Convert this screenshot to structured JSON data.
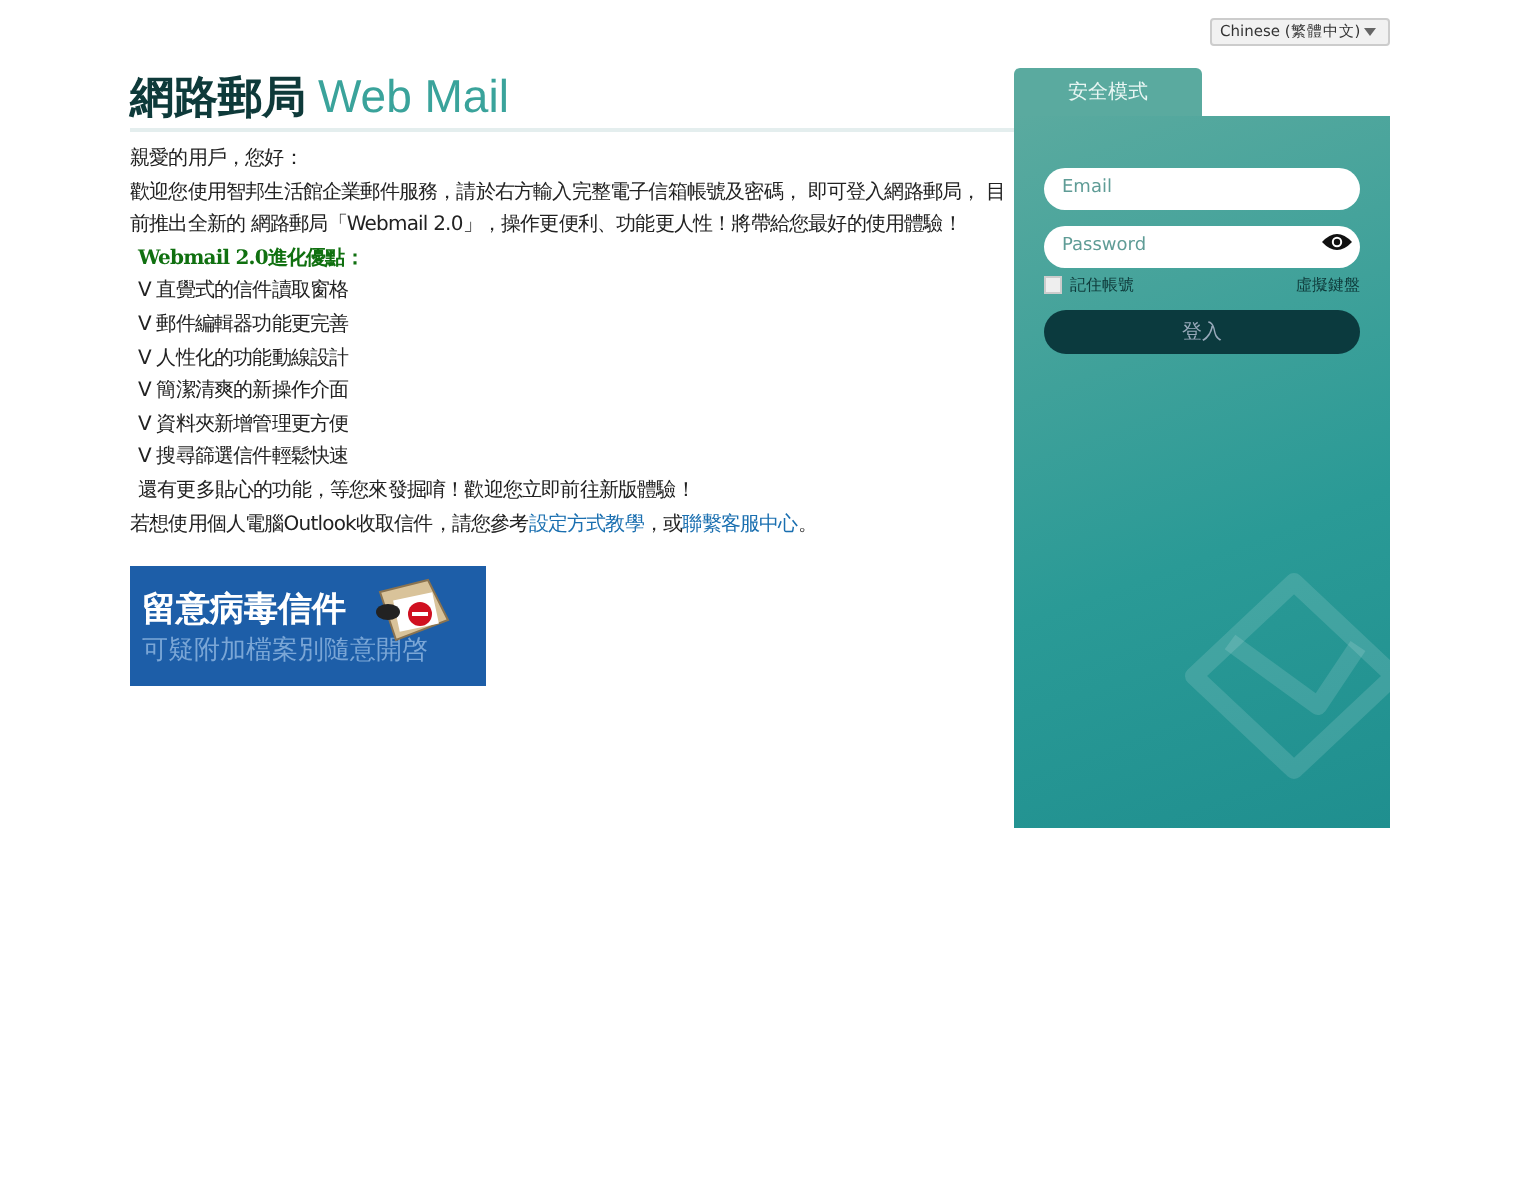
{
  "language_select": {
    "value": "Chinese (繁體中文)"
  },
  "header": {
    "title_cjk": "網路郵局",
    "title_latin": "Web Mail"
  },
  "intro": {
    "greeting": "親愛的用戶，您好：",
    "welcome": "歡迎您使用智邦生活館企業郵件服務，請於右方輸入完整電子信箱帳號及密碼， 即可登入網路郵局， 目前推出全新的 網路郵局「Webmail 2.0」，操作更便利、功能更人性！將帶給您最好的使用體驗！",
    "features_title": "Webmail 2.0進化優點：",
    "features": [
      "V 直覺式的信件讀取窗格",
      "V 郵件編輯器功能更完善",
      "V 人性化的功能動線設計",
      "V 簡潔清爽的新操作介面",
      "V 資料夾新增管理更方便",
      "V 搜尋篩選信件輕鬆快速"
    ],
    "more": "還有更多貼心的功能，等您來發掘唷！歡迎您立即前往新版體驗！",
    "outlook_prefix": "若想使用個人電腦Outlook收取信件，請您參考",
    "outlook_link1": "設定方式教學",
    "outlook_mid": "，或",
    "outlook_link2": "聯繫客服中心",
    "outlook_suffix": "。"
  },
  "banner": {
    "headline": "留意病毒信件",
    "subline": "可疑附加檔案別隨意開啓"
  },
  "login": {
    "tab": "安全模式",
    "email_placeholder": "Email",
    "password_placeholder": "Password",
    "remember_label": "記住帳號",
    "remember_checked": false,
    "keyboard_link": "虛擬鍵盤",
    "submit": "登入"
  }
}
